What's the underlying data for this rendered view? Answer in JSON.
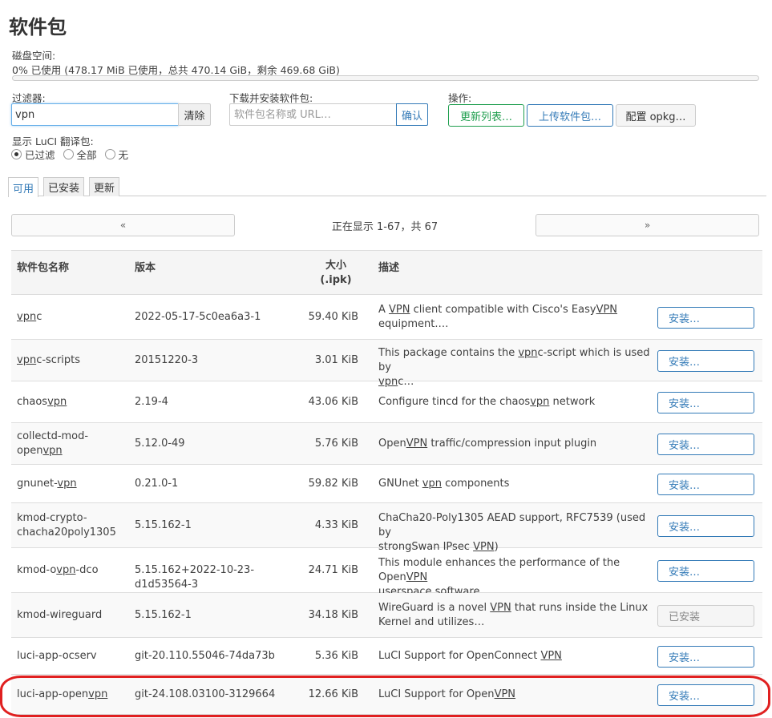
{
  "page": {
    "title": "软件包"
  },
  "disk": {
    "label": "磁盘空间:",
    "text": "0% 已使用 (478.17 MiB 已使用，总共 470.14 GiB，剩余 469.68 GiB)",
    "used_fraction": 0.0
  },
  "filter": {
    "label": "过滤器:",
    "value": "vpn",
    "clear_label": "清除"
  },
  "download": {
    "label": "下载并安装软件包:",
    "placeholder": "软件包名称或 URL…",
    "confirm_label": "确认"
  },
  "ops": {
    "label": "操作:",
    "update_label": "更新列表…",
    "upload_label": "上传软件包…",
    "config_label": "配置 opkg…"
  },
  "luci": {
    "label": "显示 LuCI 翻译包:",
    "options": [
      "已过滤",
      "全部",
      "无"
    ],
    "selected": 0
  },
  "tabs": [
    "可用",
    "已安装",
    "更新"
  ],
  "pager": {
    "prev": "«",
    "next": "»",
    "info": "正在显示 1-67，共 67"
  },
  "table": {
    "headers": {
      "name": "软件包名称",
      "version": "版本",
      "size_line1": "大小",
      "size_line2": "(.ipk)",
      "desc": "描述"
    },
    "install_label": "安装…",
    "installed_label": "已安装",
    "rows": [
      {
        "name": "vpnc",
        "version": "2022-05-17-5c0ea6a3-1",
        "size": "59.40 KiB",
        "desc1": "A VPN client compatible with Cisco's EasyVPN",
        "desc2": "equipment.…",
        "installed": false
      },
      {
        "name": "vpnc-scripts",
        "version": "20151220-3",
        "size": "3.01 KiB",
        "desc1": "This package contains the vpnc-script which is used by",
        "desc2": "vpnc…",
        "installed": false
      },
      {
        "name": "chaosvpn",
        "version": "2.19-4",
        "size": "43.06 KiB",
        "desc1": "Configure tincd for the chaosvpn network",
        "desc2": "",
        "installed": false
      },
      {
        "name1": "collectd-mod-",
        "name2": "openvpn",
        "version": "5.12.0-49",
        "size": "5.76 KiB",
        "desc1": "OpenVPN traffic/compression input plugin",
        "desc2": "",
        "installed": false
      },
      {
        "name": "gnunet-vpn",
        "version": "0.21.0-1",
        "size": "59.82 KiB",
        "desc1": "GNUnet vpn components",
        "desc2": "",
        "installed": false
      },
      {
        "name1": "kmod-crypto-",
        "name2": "chacha20poly1305",
        "version": "5.15.162-1",
        "size": "4.33 KiB",
        "desc1": "ChaCha20-Poly1305 AEAD support, RFC7539 (used by",
        "desc2": "strongSwan IPsec VPN)",
        "installed": false
      },
      {
        "name": "kmod-ovpn-dco",
        "version": "5.15.162+2022-10-23-d1d53564-3",
        "size": "24.71 KiB",
        "desc1": "This module enhances the performance of the OpenVPN",
        "desc2": "userspace software…",
        "installed": false
      },
      {
        "name": "kmod-wireguard",
        "version": "5.15.162-1",
        "size": "34.18 KiB",
        "desc1": "WireGuard is a novel VPN that runs inside the Linux",
        "desc2": "Kernel and utilizes…",
        "installed": true
      },
      {
        "name": "luci-app-ocserv",
        "version": "git-20.110.55046-74da73b",
        "size": "5.36 KiB",
        "desc1": "LuCI Support for OpenConnect VPN",
        "desc2": "",
        "installed": false
      },
      {
        "name": "luci-app-openvpn",
        "version": "git-24.108.03100-3129664",
        "size": "12.66 KiB",
        "desc1": "LuCI Support for OpenVPN",
        "desc2": "",
        "installed": false
      }
    ]
  },
  "colors": {
    "primary": "#337ab7",
    "positive": "#1f9e4e",
    "highlight": "#e02020"
  }
}
